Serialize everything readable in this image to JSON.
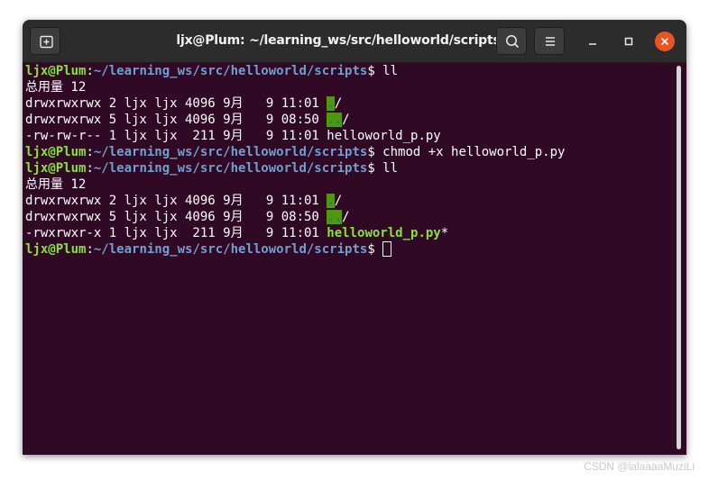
{
  "window": {
    "title": "ljx@Plum: ~/learning_ws/src/helloworld/scripts",
    "buttons": {
      "new_tab": "new-tab-icon",
      "search": "search-icon",
      "menu": "hamburger-menu-icon",
      "minimize": "minimize-icon",
      "maximize": "maximize-icon",
      "close": "close-icon"
    }
  },
  "colors": {
    "terminal_bg": "#300a24",
    "prompt_user": "#8ae234",
    "prompt_path": "#729fcf",
    "dir_highlight_bg": "#4e9a06",
    "close_button": "#e95420"
  },
  "terminal": {
    "prompt_user": "ljx@Plum",
    "prompt_colon": ":",
    "prompt_path": "~/learning_ws/src/helloworld/scripts",
    "prompt_dollar": "$ ",
    "commands": [
      "ll",
      "chmod +x helloworld_p.py",
      "ll",
      ""
    ],
    "listing1": {
      "total": "总用量 12",
      "rows": [
        {
          "meta": "drwxrwxrwx 2 ljx ljx 4096 9月   9 11:01 ",
          "name": ".",
          "suffix": "/"
        },
        {
          "meta": "drwxrwxrwx 5 ljx ljx 4096 9月   9 08:50 ",
          "name": "..",
          "suffix": "/"
        },
        {
          "meta": "-rw-rw-r-- 1 ljx ljx  211 9月   9 11:01 ",
          "name": "helloworld_p.py",
          "suffix": ""
        }
      ]
    },
    "listing2": {
      "total": "总用量 12",
      "rows": [
        {
          "meta": "drwxrwxrwx 2 ljx ljx 4096 9月   9 11:01 ",
          "name": ".",
          "suffix": "/"
        },
        {
          "meta": "drwxrwxrwx 5 ljx ljx 4096 9月   9 08:50 ",
          "name": "..",
          "suffix": "/"
        },
        {
          "meta": "-rwxrwxr-x 1 ljx ljx  211 9月   9 11:01 ",
          "name": "helloworld_p.py",
          "suffix": "*"
        }
      ]
    }
  },
  "watermark": "CSDN @lalaaaaMuziLi"
}
